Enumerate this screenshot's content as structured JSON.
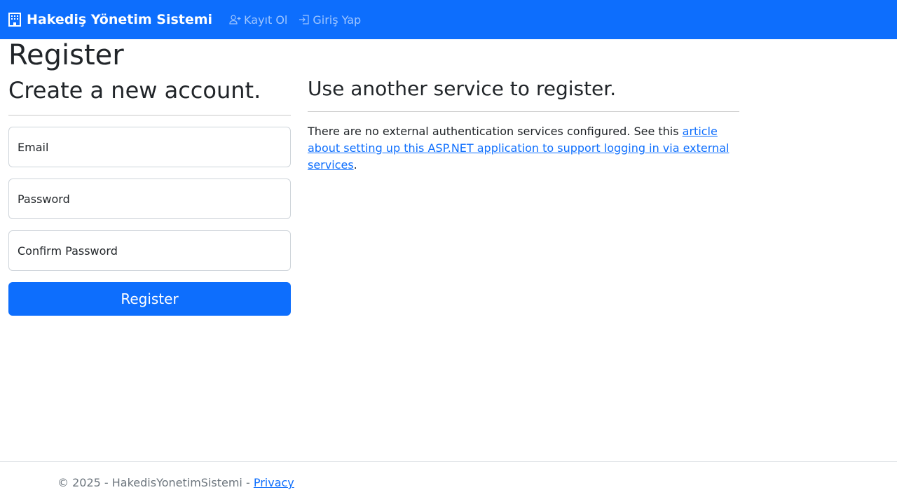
{
  "nav": {
    "brand": "Hakediş Yönetim Sistemi",
    "links": [
      {
        "label": "Kayıt Ol",
        "icon": "person-plus-icon"
      },
      {
        "label": "Giriş Yap",
        "icon": "box-arrow-in-right-icon"
      }
    ]
  },
  "page_title": "Register",
  "form": {
    "heading": "Create a new account.",
    "email": "Email",
    "password": "Password",
    "confirm": "Confirm Password",
    "submit": "Register"
  },
  "external": {
    "heading": "Use another service to register.",
    "text_before": "There are no external authentication services configured. See this ",
    "link": "article about setting up this ASP.NET application to support logging in via external services",
    "text_after": "."
  },
  "footer": {
    "text": "© 2025 - HakedisYonetimSistemi - ",
    "link": "Privacy"
  }
}
